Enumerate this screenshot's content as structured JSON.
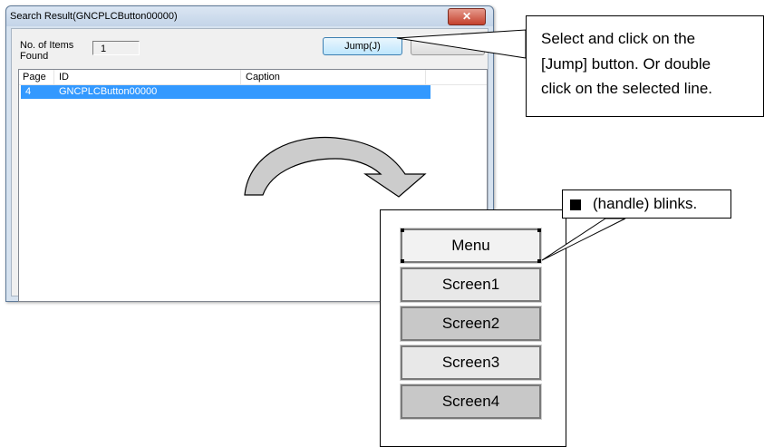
{
  "dialog": {
    "title": "Search Result(GNCPLCButton00000)",
    "close_glyph": "✕",
    "count_label": "No. of Items Found",
    "count_value": "1",
    "jump_button": "Jump(J)",
    "columns": [
      "Page",
      "ID",
      "Caption"
    ],
    "rows": [
      {
        "page": "4",
        "id": "GNCPLCButton00000",
        "caption": ""
      }
    ]
  },
  "callout_select": {
    "lines": [
      "Select and click on the",
      "[Jump] button. Or double",
      "click on the selected line."
    ]
  },
  "callout_handle": {
    "text": "(handle) blinks."
  },
  "screen_buttons": [
    {
      "label": "Menu",
      "fill": "#f2f2f2",
      "selected": true
    },
    {
      "label": "Screen1",
      "fill": "#e8e8e8",
      "selected": false
    },
    {
      "label": "Screen2",
      "fill": "#c8c8c8",
      "selected": false
    },
    {
      "label": "Screen3",
      "fill": "#e8e8e8",
      "selected": false
    },
    {
      "label": "Screen4",
      "fill": "#c8c8c8",
      "selected": false
    }
  ],
  "colors": {
    "selection": "#3399ff",
    "arrow_fill": "#cccccc"
  }
}
